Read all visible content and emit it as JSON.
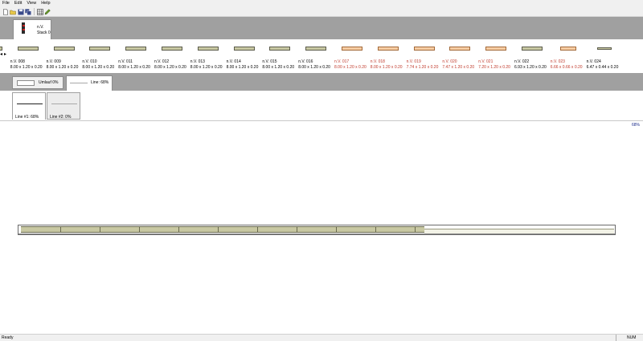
{
  "menu": [
    "File",
    "Edit",
    "View",
    "Help"
  ],
  "toolbar": {
    "buttons": [
      "new-file-icon",
      "open-folder-icon",
      "save-icon",
      "save-all-icon",
      "grid-icon",
      "edit-pencil-icon"
    ]
  },
  "stack": {
    "title": "n.V.",
    "subtitle": "Stack 0"
  },
  "parts": [
    {
      "name": "",
      "dims": ".20",
      "state": "normal"
    },
    {
      "name": "n.V. 008",
      "dims": "8.00 x 1.20 x 0.20",
      "state": "normal"
    },
    {
      "name": "n.V. 009",
      "dims": "8.00 x 1.20 x 0.20",
      "state": "normal"
    },
    {
      "name": "n.V. 010",
      "dims": "8.00 x 1.20 x 0.20",
      "state": "normal"
    },
    {
      "name": "n.V. 011",
      "dims": "8.00 x 1.20 x 0.20",
      "state": "normal"
    },
    {
      "name": "n.V. 012",
      "dims": "8.00 x 1.20 x 0.20",
      "state": "normal"
    },
    {
      "name": "n.V. 013",
      "dims": "8.00 x 1.20 x 0.20",
      "state": "normal"
    },
    {
      "name": "n.V. 014",
      "dims": "8.00 x 1.20 x 0.20",
      "state": "normal"
    },
    {
      "name": "n.V. 015",
      "dims": "8.00 x 1.20 x 0.20",
      "state": "normal"
    },
    {
      "name": "n.V. 016",
      "dims": "8.00 x 1.20 x 0.20",
      "state": "normal"
    },
    {
      "name": "n.V. 017",
      "dims": "8.00 x 1.20 x 0.20",
      "state": "red"
    },
    {
      "name": "n.V. 018",
      "dims": "8.00 x 1.20 x 0.20",
      "state": "red"
    },
    {
      "name": "n.V. 019",
      "dims": "7.74 x 1.20 x 0.20",
      "state": "red"
    },
    {
      "name": "n.V. 020",
      "dims": "7.47 x 1.20 x 0.20",
      "state": "red"
    },
    {
      "name": "n.V. 021",
      "dims": "7.20 x 1.20 x 0.20",
      "state": "red"
    },
    {
      "name": "n.V. 022",
      "dims": "6.93 x 1.20 x 0.20",
      "state": "normal"
    },
    {
      "name": "n.V. 023",
      "dims": "6.66 x 0.66 x 0.20",
      "state": "red"
    },
    {
      "name": "n.V. 024",
      "dims": "6.47 x 0.44 x 0.20",
      "state": "normal"
    }
  ],
  "line_bar": {
    "unlauf_label": "Umlauf 0%",
    "line_label": "Line: 68%"
  },
  "lines": [
    {
      "label": "Line #1: 68%"
    },
    {
      "label": "Line #2: 0%"
    }
  ],
  "canvas": {
    "percent": "68%",
    "fill_fraction": 0.68
  },
  "status": {
    "ready": "Ready",
    "num": "NUM"
  },
  "colors": {
    "chrome_gray": "#a0a0a0",
    "piece_fill": "#c8c8a2",
    "warning_fill": "#f7cda4",
    "warning_text": "#c0392b"
  }
}
